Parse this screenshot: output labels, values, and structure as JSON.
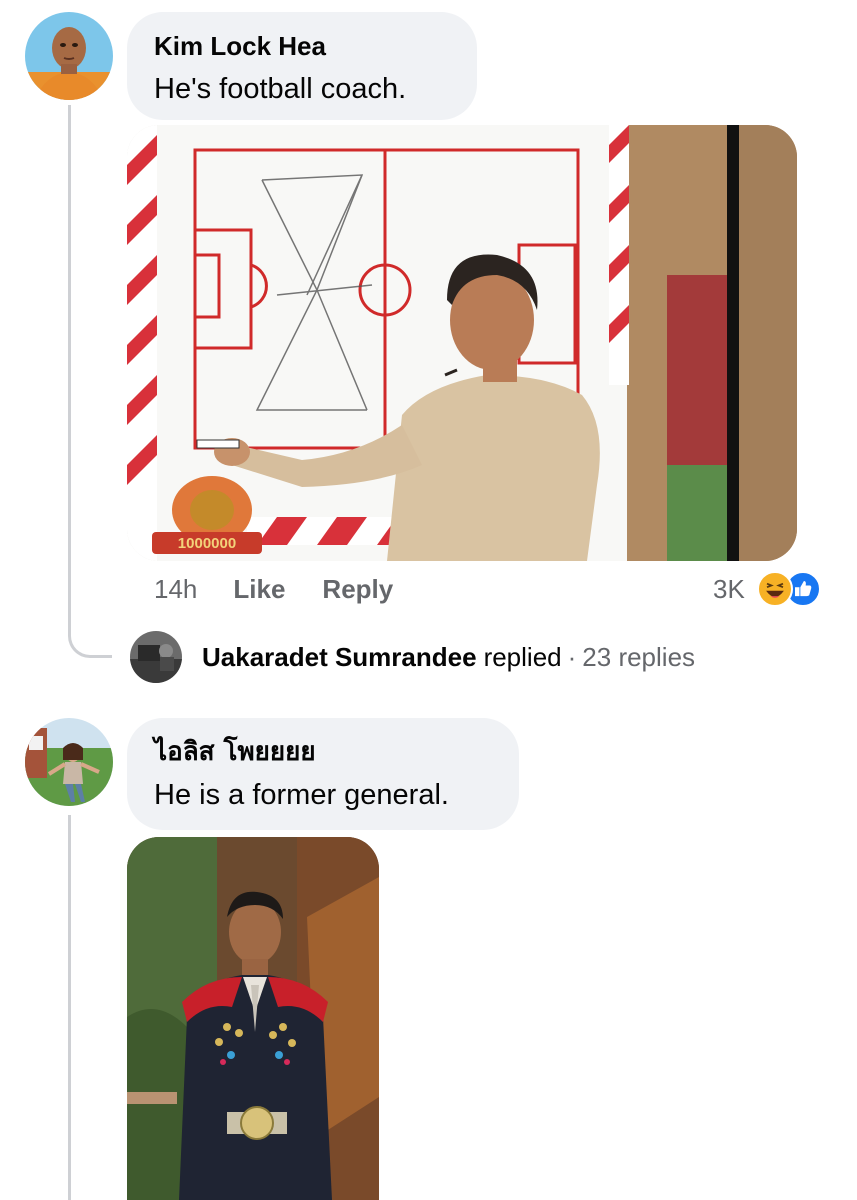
{
  "comments": [
    {
      "author": "Kim Lock Hea",
      "text": "He's football coach.",
      "image_overlay_text": "1000000",
      "time": "14h",
      "like_label": "Like",
      "reply_label": "Reply",
      "reaction_count": "3K",
      "reaction_icons": [
        "haha-icon",
        "like-icon"
      ],
      "replies_summary": {
        "name": "Uakaradet Sumrandee",
        "verb": "replied",
        "separator": "·",
        "count": "23 replies"
      }
    },
    {
      "author": "ไอลิส โพยยยย",
      "text": "He is a former general."
    }
  ],
  "colors": {
    "bubble": "#f0f2f5",
    "thread_line": "#ced0d4",
    "secondary_text": "#65676b",
    "like_blue": "#1877f2",
    "haha_yellow": "#f7b125"
  }
}
